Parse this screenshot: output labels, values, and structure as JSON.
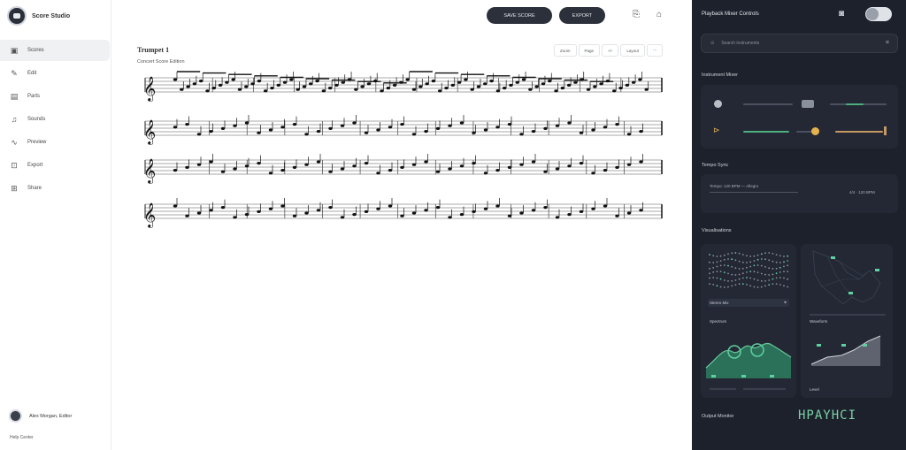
{
  "app": {
    "name": "Score Studio"
  },
  "sidebar": {
    "items": [
      {
        "label": "Scores",
        "icon": "document-icon",
        "glyph": "▣",
        "active": true
      },
      {
        "label": "Edit",
        "icon": "pencil-icon",
        "glyph": "✎",
        "active": false
      },
      {
        "label": "Parts",
        "icon": "layers-icon",
        "glyph": "▤",
        "active": false
      },
      {
        "label": "Sounds",
        "icon": "speaker-icon",
        "glyph": "♫",
        "active": false
      },
      {
        "label": "Preview",
        "icon": "waveform-icon",
        "glyph": "∿",
        "active": false
      },
      {
        "label": "Export",
        "icon": "export-icon",
        "glyph": "⊡",
        "active": false
      },
      {
        "label": "Share",
        "icon": "share-icon",
        "glyph": "⊞",
        "active": false
      }
    ],
    "user_name": "Alex Morgan, Editor",
    "footer": "Help Center"
  },
  "toolbar": {
    "primary_label": "SAVE SCORE",
    "secondary_label": "EXPORT"
  },
  "score": {
    "title": "Trumpet 1",
    "subtitle": "Concert Score Edition",
    "tools": [
      "Zoom",
      "Page",
      "+/-",
      "Layout",
      "⋯"
    ]
  },
  "panel": {
    "title": "Playback Mixer Controls",
    "search_placeholder": "Search instruments",
    "sections": {
      "mixer": "Instrument Mixer",
      "tempo": "Tempo Sync",
      "visual": "Visualisations",
      "output": "Output Monitor"
    },
    "tempo_text": "Tempo: 120 BPM — Allegro",
    "tempo_right": "4/4 · 120 BPM",
    "viz_captions": [
      "Spectrum",
      "Waveform",
      "Level"
    ],
    "viz_dropdown": "Stereo Mix",
    "brand_text": "HPAYHCI"
  },
  "colors": {
    "accent": "#4cae7d",
    "panel_bg": "#1c212b",
    "dark_button": "#2b303b"
  }
}
